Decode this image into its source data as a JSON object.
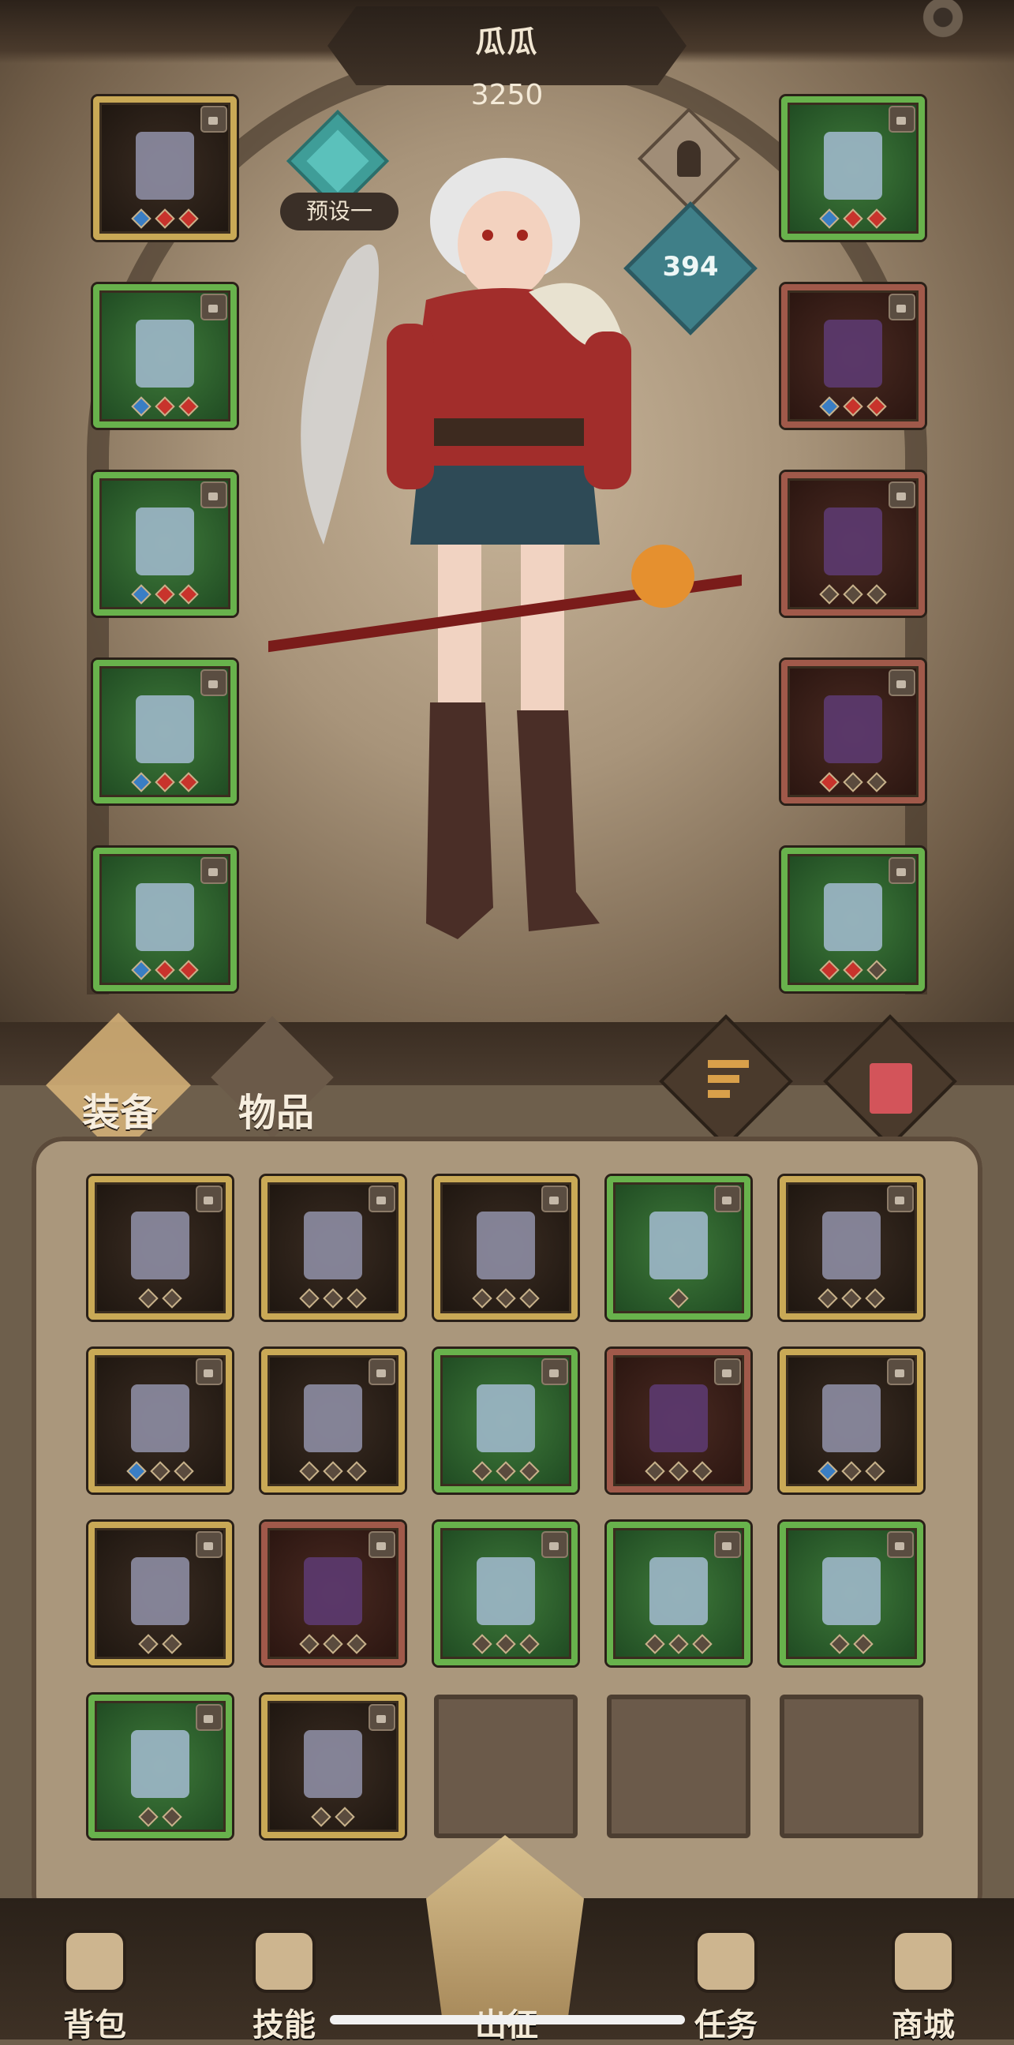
{
  "character": {
    "name": "瓜瓜",
    "power": "3250",
    "preset_label": "预设一",
    "level": "394"
  },
  "left_slots": [
    {
      "name": "cape-slot",
      "rarity": "gold",
      "gems": [
        "b",
        "r",
        "r"
      ]
    },
    {
      "name": "armor-slot",
      "rarity": "green",
      "gems": [
        "b",
        "r",
        "r"
      ]
    },
    {
      "name": "bracer-slot",
      "rarity": "green",
      "gems": [
        "b",
        "r",
        "r"
      ]
    },
    {
      "name": "gloves-slot",
      "rarity": "green",
      "gems": [
        "b",
        "r",
        "r"
      ]
    },
    {
      "name": "boots-slot",
      "rarity": "green",
      "gems": [
        "b",
        "r",
        "r"
      ]
    }
  ],
  "right_slots": [
    {
      "name": "necklace-slot",
      "rarity": "green",
      "gems": [
        "b",
        "r",
        "r"
      ]
    },
    {
      "name": "helmet-slot",
      "rarity": "red",
      "gems": [
        "b",
        "r",
        "r"
      ]
    },
    {
      "name": "ring-slot",
      "rarity": "red",
      "gems": [
        "n",
        "n",
        "n"
      ]
    },
    {
      "name": "sword-slot",
      "rarity": "red",
      "gems": [
        "r",
        "n",
        "n"
      ]
    },
    {
      "name": "staff-slot",
      "rarity": "green",
      "gems": [
        "r",
        "r",
        "n"
      ]
    }
  ],
  "tabs": {
    "equipment": "装备",
    "items": "物品"
  },
  "inventory": [
    {
      "name": "staff-item",
      "rarity": "gold",
      "gems": [
        "n",
        "n"
      ]
    },
    {
      "name": "sword-item",
      "rarity": "gold",
      "gems": [
        "n",
        "n",
        "n"
      ]
    },
    {
      "name": "pendant-item",
      "rarity": "gold",
      "gems": [
        "n",
        "n",
        "n"
      ]
    },
    {
      "name": "necklace-item",
      "rarity": "green",
      "gems": [
        "n"
      ]
    },
    {
      "name": "sword-item",
      "rarity": "gold",
      "gems": [
        "n",
        "n",
        "n"
      ]
    },
    {
      "name": "ring-item",
      "rarity": "gold",
      "gems": [
        "b",
        "n",
        "n"
      ]
    },
    {
      "name": "spear-item",
      "rarity": "gold",
      "gems": [
        "n",
        "n",
        "n"
      ]
    },
    {
      "name": "helmet-item",
      "rarity": "green",
      "gems": [
        "n",
        "n",
        "n"
      ]
    },
    {
      "name": "gauntlet-item",
      "rarity": "red",
      "gems": [
        "n",
        "n",
        "n"
      ]
    },
    {
      "name": "sword-item",
      "rarity": "gold",
      "gems": [
        "b",
        "n",
        "n"
      ]
    },
    {
      "name": "sword-item",
      "rarity": "gold",
      "gems": [
        "n",
        "n"
      ]
    },
    {
      "name": "amulet-item",
      "rarity": "red",
      "gems": [
        "n",
        "n",
        "n"
      ]
    },
    {
      "name": "armor-item",
      "rarity": "green",
      "gems": [
        "n",
        "n",
        "n"
      ]
    },
    {
      "name": "boots-item",
      "rarity": "green",
      "gems": [
        "n",
        "n",
        "n"
      ]
    },
    {
      "name": "bracer-item",
      "rarity": "green",
      "gems": [
        "n",
        "n"
      ]
    },
    {
      "name": "skirt-item",
      "rarity": "green",
      "gems": [
        "n",
        "n"
      ]
    },
    {
      "name": "sword-item",
      "rarity": "gold",
      "gems": [
        "n",
        "n"
      ]
    },
    {
      "name": "empty-slot",
      "rarity": "empty",
      "gems": []
    },
    {
      "name": "empty-slot",
      "rarity": "empty",
      "gems": []
    },
    {
      "name": "empty-slot",
      "rarity": "empty",
      "gems": []
    }
  ],
  "nav": {
    "backpack": "背包",
    "skills": "技能",
    "expedition": "出征",
    "quests": "任务",
    "shop": "商城"
  },
  "colors": {
    "green_frame": "#68b24c",
    "gold_frame": "#c9a956",
    "red_frame": "#a0594a",
    "gem_red": "#c8332c",
    "gem_blue": "#3a7ec4"
  }
}
